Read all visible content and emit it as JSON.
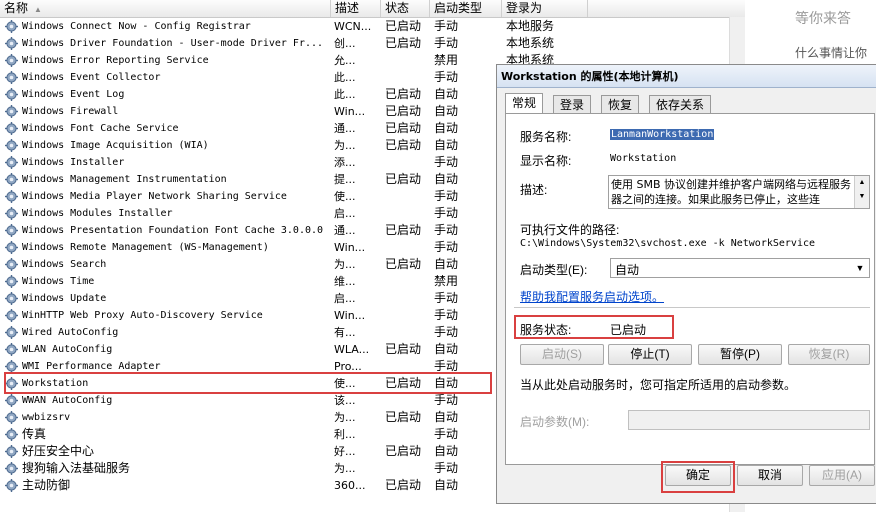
{
  "columns": {
    "name": "名称",
    "desc": "描述",
    "status": "状态",
    "startup": "启动类型",
    "logon": "登录为"
  },
  "services": [
    {
      "name": "Windows Connect Now - Config Registrar",
      "desc": "WCN...",
      "status": "已启动",
      "startup": "手动",
      "logon": "本地服务"
    },
    {
      "name": "Windows Driver Foundation - User-mode Driver Fr...",
      "desc": "创...",
      "status": "已启动",
      "startup": "手动",
      "logon": "本地系统"
    },
    {
      "name": "Windows Error Reporting Service",
      "desc": "允...",
      "status": "",
      "startup": "禁用",
      "logon": "本地系统"
    },
    {
      "name": "Windows Event Collector",
      "desc": "此...",
      "status": "",
      "startup": "手动",
      "logon": ""
    },
    {
      "name": "Windows Event Log",
      "desc": "此...",
      "status": "已启动",
      "startup": "自动",
      "logon": ""
    },
    {
      "name": "Windows Firewall",
      "desc": "Win...",
      "status": "已启动",
      "startup": "自动",
      "logon": ""
    },
    {
      "name": "Windows Font Cache Service",
      "desc": "通...",
      "status": "已启动",
      "startup": "自动",
      "logon": ""
    },
    {
      "name": "Windows Image Acquisition (WIA)",
      "desc": "为...",
      "status": "已启动",
      "startup": "自动",
      "logon": ""
    },
    {
      "name": "Windows Installer",
      "desc": "添...",
      "status": "",
      "startup": "手动",
      "logon": ""
    },
    {
      "name": "Windows Management Instrumentation",
      "desc": "提...",
      "status": "已启动",
      "startup": "自动",
      "logon": ""
    },
    {
      "name": "Windows Media Player Network Sharing Service",
      "desc": "使...",
      "status": "",
      "startup": "手动",
      "logon": ""
    },
    {
      "name": "Windows Modules Installer",
      "desc": "启...",
      "status": "",
      "startup": "手动",
      "logon": ""
    },
    {
      "name": "Windows Presentation Foundation Font Cache 3.0.0.0",
      "desc": "通...",
      "status": "已启动",
      "startup": "手动",
      "logon": ""
    },
    {
      "name": "Windows Remote Management (WS-Management)",
      "desc": "Win...",
      "status": "",
      "startup": "手动",
      "logon": ""
    },
    {
      "name": "Windows Search",
      "desc": "为...",
      "status": "已启动",
      "startup": "自动",
      "logon": ""
    },
    {
      "name": "Windows Time",
      "desc": "维...",
      "status": "",
      "startup": "禁用",
      "logon": ""
    },
    {
      "name": "Windows Update",
      "desc": "启...",
      "status": "",
      "startup": "手动",
      "logon": ""
    },
    {
      "name": "WinHTTP Web Proxy Auto-Discovery Service",
      "desc": "Win...",
      "status": "",
      "startup": "手动",
      "logon": ""
    },
    {
      "name": "Wired AutoConfig",
      "desc": "有...",
      "status": "",
      "startup": "手动",
      "logon": ""
    },
    {
      "name": "WLAN AutoConfig",
      "desc": "WLA...",
      "status": "已启动",
      "startup": "自动",
      "logon": ""
    },
    {
      "name": "WMI Performance Adapter",
      "desc": "Pro...",
      "status": "",
      "startup": "手动",
      "logon": ""
    },
    {
      "name": "Workstation",
      "desc": "使...",
      "status": "已启动",
      "startup": "自动",
      "logon": ""
    },
    {
      "name": "WWAN AutoConfig",
      "desc": "该...",
      "status": "",
      "startup": "手动",
      "logon": ""
    },
    {
      "name": "wwbizsrv",
      "desc": "为...",
      "status": "已启动",
      "startup": "自动",
      "logon": ""
    },
    {
      "name": "传真",
      "desc": "利...",
      "status": "",
      "startup": "手动",
      "logon": ""
    },
    {
      "name": "好压安全中心",
      "desc": "好...",
      "status": "已启动",
      "startup": "自动",
      "logon": ""
    },
    {
      "name": "搜狗输入法基础服务",
      "desc": "为...",
      "status": "",
      "startup": "手动",
      "logon": ""
    },
    {
      "name": "主动防御",
      "desc": "360...",
      "status": "已启动",
      "startup": "自动",
      "logon": ""
    }
  ],
  "side": {
    "line1": "等你来答",
    "line2": "什么事情让你"
  },
  "dialog": {
    "title": "Workstation 的属性(本地计算机)",
    "tabs": [
      "常规",
      "登录",
      "恢复",
      "依存关系"
    ],
    "service_name_label": "服务名称:",
    "service_name": "LanmanWorkstation",
    "display_name_label": "显示名称:",
    "display_name": "Workstation",
    "desc_label": "描述:",
    "desc_text": "使用 SMB 协议创建并维护客户端网络与远程服务器之间的连接。如果此服务已停止，这些连",
    "exe_label": "可执行文件的路径:",
    "exe_path": "C:\\Windows\\System32\\svchost.exe -k NetworkService",
    "startup_label": "启动类型(E):",
    "startup_value": "自动",
    "help_link": "帮助我配置服务启动选项。",
    "status_label": "服务状态:",
    "status_value": "已启动",
    "btn_start": "启动(S)",
    "btn_stop": "停止(T)",
    "btn_pause": "暂停(P)",
    "btn_resume": "恢复(R)",
    "hint": "当从此处启动服务时，您可指定所适用的启动参数。",
    "params_label": "启动参数(M):",
    "ok": "确定",
    "cancel": "取消",
    "apply": "应用(A)"
  },
  "colors": {
    "highlight": "#d94040",
    "link": "#0044cc"
  }
}
